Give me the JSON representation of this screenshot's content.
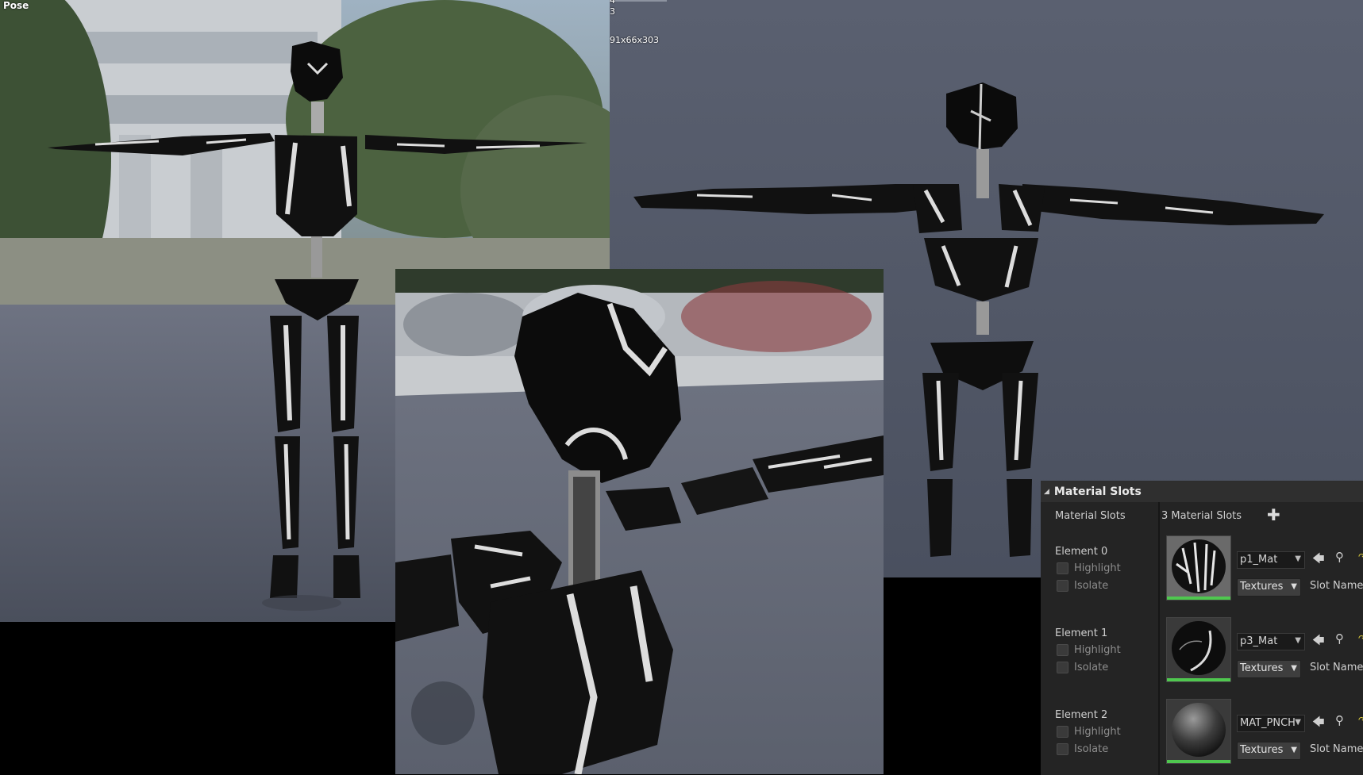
{
  "viewport_left": {
    "title": "Pose"
  },
  "viewport_right": {
    "stats_lines": [
      "4",
      "3",
      "91x66x303"
    ]
  },
  "material_panel": {
    "title": "Material Slots",
    "slots_label": "Material Slots",
    "slot_count": "3 Material Slots",
    "add_icon": "plus-icon",
    "highlight_label": "Highlight",
    "isolate_label": "Isolate",
    "textures_label": "Textures",
    "slot_name_label": "Slot Name",
    "accent_green": "#4fc84f",
    "elements": [
      {
        "label": "Element 0",
        "material": "p1_Mat",
        "thumb": "striped-sphere"
      },
      {
        "label": "Element 1",
        "material": "p3_Mat",
        "thumb": "dark-sphere-line"
      },
      {
        "label": "Element 2",
        "material": "MAT_PNCH",
        "thumb": "grey-sphere"
      }
    ]
  }
}
